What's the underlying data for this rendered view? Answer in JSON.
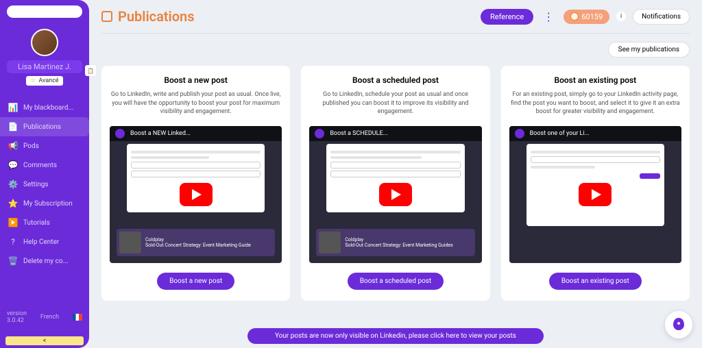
{
  "sidebar": {
    "user_name": "Lisa Martinez J.",
    "badge_label": "Avancé",
    "nav": [
      {
        "icon": "📊",
        "label": "My blackboard..."
      },
      {
        "icon": "📄",
        "label": "Publications"
      },
      {
        "icon": "📢",
        "label": "Pods"
      },
      {
        "icon": "💬",
        "label": "Comments"
      },
      {
        "icon": "⚙️",
        "label": "Settings"
      },
      {
        "icon": "⭐",
        "label": "My Subscription"
      },
      {
        "icon": "▶️",
        "label": "Tutorials"
      },
      {
        "icon": "?",
        "label": "Help Center"
      },
      {
        "icon": "🗑️",
        "label": "Delete my co..."
      }
    ],
    "version_label": "version",
    "version": "3.0.42",
    "language": "French",
    "collapse": "<"
  },
  "header": {
    "title": "Publications",
    "reference_btn": "Reference",
    "count": "60159",
    "notifications_btn": "Notifications",
    "see_publications_btn": "See my publications"
  },
  "cards": [
    {
      "title": "Boost a new post",
      "desc": "Go to LinkedIn, write and publish your post as usual. Once live, you will have the opportunity to boost your post for maximum visibility and engagement.",
      "video_title": "Boost a NEW Linked...",
      "bg_title": "Coldplay",
      "bg_sub": "Sold-Out Concert Strategy: Event Marketing Guide",
      "cta": "Boost a new post"
    },
    {
      "title": "Boost a scheduled post",
      "desc": "Go to LinkedIn, schedule your post as usual and once published you can boost it to improve its visibility and engagement.",
      "video_title": "Boost a SCHEDULE...",
      "bg_title": "Coldplay",
      "bg_sub": "Sold-Out Concert Strategy: Event Marketing Guides",
      "cta": "Boost a scheduled post"
    },
    {
      "title": "Boost an existing post",
      "desc": "For an existing post, simply go to your LinkedIn activity page, find the post you want to boost, and select it to give it an extra boost for greater visibility and engagement.",
      "video_title": "Boost one of your Li...",
      "bg_title": "",
      "bg_sub": "",
      "cta": "Boost an existing post"
    }
  ],
  "banner": "Your posts are now only visible on Linkedin, please click here to view your posts"
}
